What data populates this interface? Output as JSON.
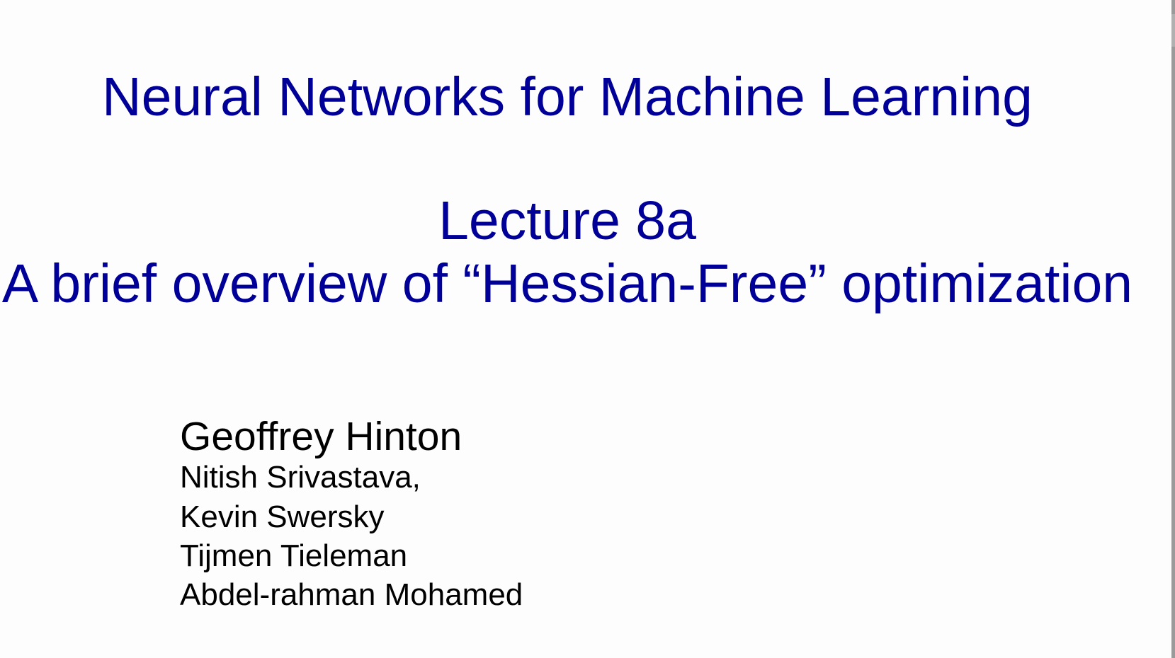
{
  "slide": {
    "title": "Neural Networks for Machine Learning",
    "lecture": "Lecture 8a",
    "subtitle": "A brief overview of “Hessian-Free” optimization",
    "author_main": "Geoffrey Hinton",
    "coauthors": [
      "Nitish Srivastava,",
      "Kevin Swersky",
      "Tijmen Tieleman",
      "Abdel-rahman Mohamed"
    ]
  },
  "colors": {
    "title": "#000099",
    "authors": "#000000"
  }
}
